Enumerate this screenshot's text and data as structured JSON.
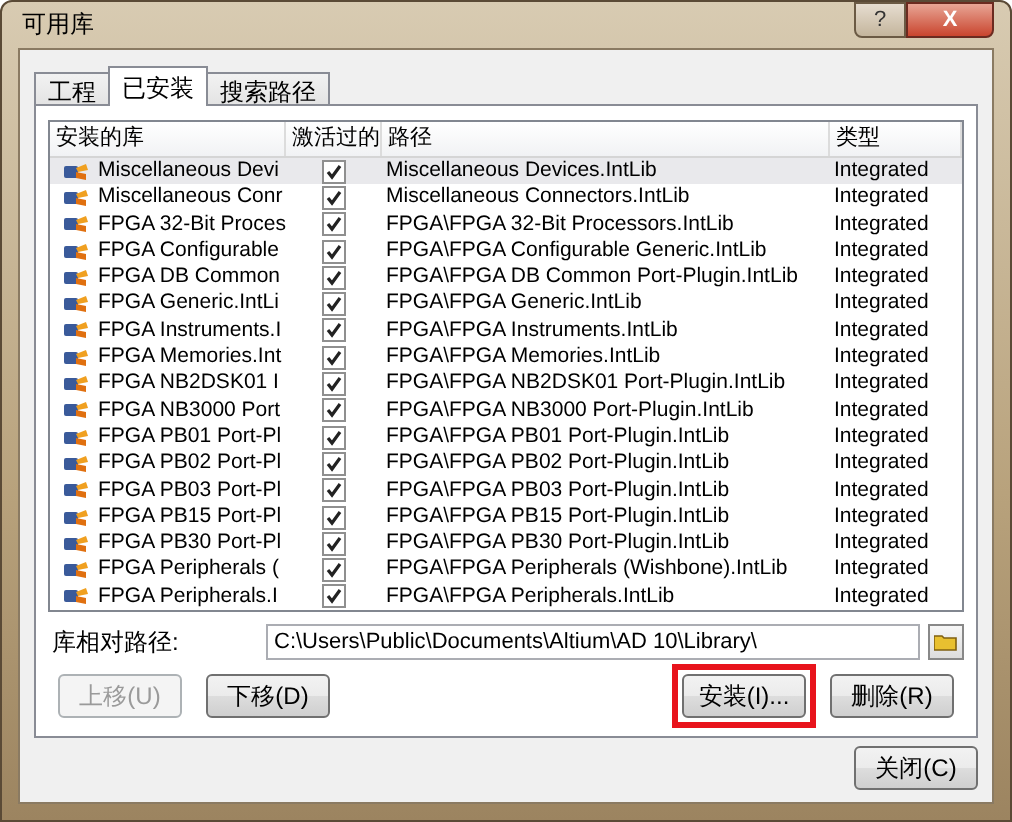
{
  "window": {
    "title": "可用库",
    "help_button": "?",
    "close_button": "X"
  },
  "tabs": [
    {
      "label": "工程",
      "selected": false
    },
    {
      "label": "已安装",
      "selected": true
    },
    {
      "label": "搜索路径",
      "selected": false
    }
  ],
  "table": {
    "columns": [
      "安装的库",
      "激活过的",
      "路径",
      "类型"
    ],
    "rows": [
      {
        "name": "Miscellaneous Devi",
        "checked": true,
        "path": "Miscellaneous Devices.IntLib",
        "type": "Integrated",
        "selected": true
      },
      {
        "name": "Miscellaneous Conr",
        "checked": true,
        "path": "Miscellaneous Connectors.IntLib",
        "type": "Integrated",
        "selected": false
      },
      {
        "name": "FPGA 32-Bit Proces",
        "checked": true,
        "path": "FPGA\\FPGA 32-Bit Processors.IntLib",
        "type": "Integrated",
        "selected": false
      },
      {
        "name": "FPGA Configurable",
        "checked": true,
        "path": "FPGA\\FPGA Configurable Generic.IntLib",
        "type": "Integrated",
        "selected": false
      },
      {
        "name": "FPGA DB Common",
        "checked": true,
        "path": "FPGA\\FPGA DB Common Port-Plugin.IntLib",
        "type": "Integrated",
        "selected": false
      },
      {
        "name": "FPGA Generic.IntLi",
        "checked": true,
        "path": "FPGA\\FPGA Generic.IntLib",
        "type": "Integrated",
        "selected": false
      },
      {
        "name": "FPGA Instruments.I",
        "checked": true,
        "path": "FPGA\\FPGA Instruments.IntLib",
        "type": "Integrated",
        "selected": false
      },
      {
        "name": "FPGA Memories.Int",
        "checked": true,
        "path": "FPGA\\FPGA Memories.IntLib",
        "type": "Integrated",
        "selected": false
      },
      {
        "name": "FPGA NB2DSK01 I",
        "checked": true,
        "path": "FPGA\\FPGA NB2DSK01 Port-Plugin.IntLib",
        "type": "Integrated",
        "selected": false
      },
      {
        "name": "FPGA NB3000 Port",
        "checked": true,
        "path": "FPGA\\FPGA NB3000 Port-Plugin.IntLib",
        "type": "Integrated",
        "selected": false
      },
      {
        "name": "FPGA PB01 Port-Pl",
        "checked": true,
        "path": "FPGA\\FPGA PB01 Port-Plugin.IntLib",
        "type": "Integrated",
        "selected": false
      },
      {
        "name": "FPGA PB02 Port-Pl",
        "checked": true,
        "path": "FPGA\\FPGA PB02 Port-Plugin.IntLib",
        "type": "Integrated",
        "selected": false
      },
      {
        "name": "FPGA PB03 Port-Pl",
        "checked": true,
        "path": "FPGA\\FPGA PB03 Port-Plugin.IntLib",
        "type": "Integrated",
        "selected": false
      },
      {
        "name": "FPGA PB15 Port-Pl",
        "checked": true,
        "path": "FPGA\\FPGA PB15 Port-Plugin.IntLib",
        "type": "Integrated",
        "selected": false
      },
      {
        "name": "FPGA PB30 Port-Pl",
        "checked": true,
        "path": "FPGA\\FPGA PB30 Port-Plugin.IntLib",
        "type": "Integrated",
        "selected": false
      },
      {
        "name": "FPGA Peripherals (",
        "checked": true,
        "path": "FPGA\\FPGA Peripherals (Wishbone).IntLib",
        "type": "Integrated",
        "selected": false
      },
      {
        "name": "FPGA Peripherals.I",
        "checked": true,
        "path": "FPGA\\FPGA Peripherals.IntLib",
        "type": "Integrated",
        "selected": false
      }
    ]
  },
  "library_path": {
    "label": "库相对路径:",
    "value": "C:\\Users\\Public\\Documents\\Altium\\AD 10\\Library\\"
  },
  "buttons": [
    {
      "label": "上移(U)",
      "kind": "left",
      "disabled": true,
      "highlighted": false
    },
    {
      "label": "下移(D)",
      "kind": "left",
      "disabled": false,
      "highlighted": false
    },
    {
      "label": "安装(I)...",
      "kind": "right",
      "disabled": false,
      "highlighted": true
    },
    {
      "label": "删除(R)",
      "kind": "right",
      "disabled": false,
      "highlighted": false
    }
  ],
  "close": {
    "label": "关闭(C)"
  }
}
